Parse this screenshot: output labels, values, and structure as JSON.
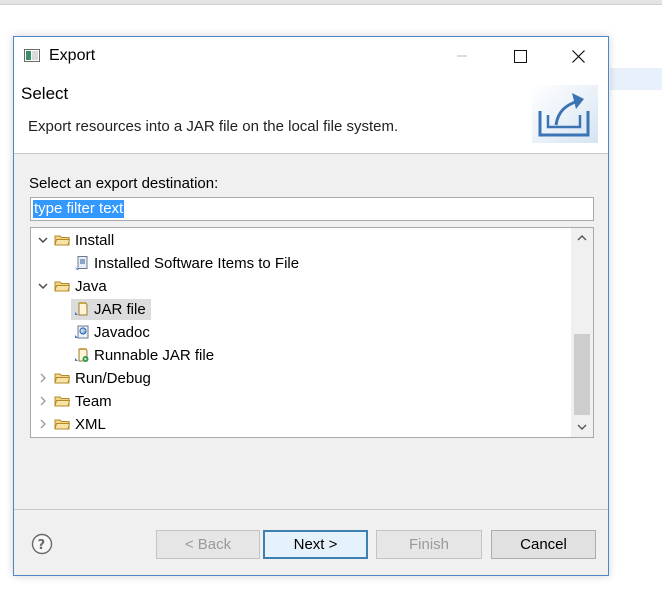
{
  "window": {
    "title": "Export",
    "controls": [
      "minimize",
      "maximize",
      "close"
    ]
  },
  "banner": {
    "title": "Select",
    "description": "Export resources into a JAR file on the local file system.",
    "icon": "export-wizard-icon"
  },
  "filter": {
    "label": "Select an export destination:",
    "value": "type filter text",
    "selected": true
  },
  "tree": {
    "items": [
      {
        "label": "Install",
        "expanded": true,
        "level": 0,
        "icon": "folder-icon"
      },
      {
        "label": "Installed Software Items to File",
        "level": 1,
        "icon": "installed-software-icon"
      },
      {
        "label": "Java",
        "expanded": true,
        "level": 0,
        "icon": "folder-icon"
      },
      {
        "label": "JAR file",
        "level": 1,
        "icon": "jar-file-icon",
        "selected": true
      },
      {
        "label": "Javadoc",
        "level": 1,
        "icon": "javadoc-icon"
      },
      {
        "label": "Runnable JAR file",
        "level": 1,
        "icon": "runnable-jar-icon"
      },
      {
        "label": "Run/Debug",
        "expanded": false,
        "level": 0,
        "icon": "folder-icon"
      },
      {
        "label": "Team",
        "expanded": false,
        "level": 0,
        "icon": "folder-icon"
      },
      {
        "label": "XML",
        "expanded": false,
        "level": 0,
        "icon": "folder-icon"
      }
    ],
    "scroll_position": 1.0
  },
  "buttons": {
    "help": "help-icon",
    "back": "< Back",
    "next": "Next >",
    "finish": "Finish",
    "cancel": "Cancel"
  },
  "colors": {
    "accent": "#3c7fb1",
    "selection": "#3399ff",
    "dialog_border": "#4f86c6"
  }
}
